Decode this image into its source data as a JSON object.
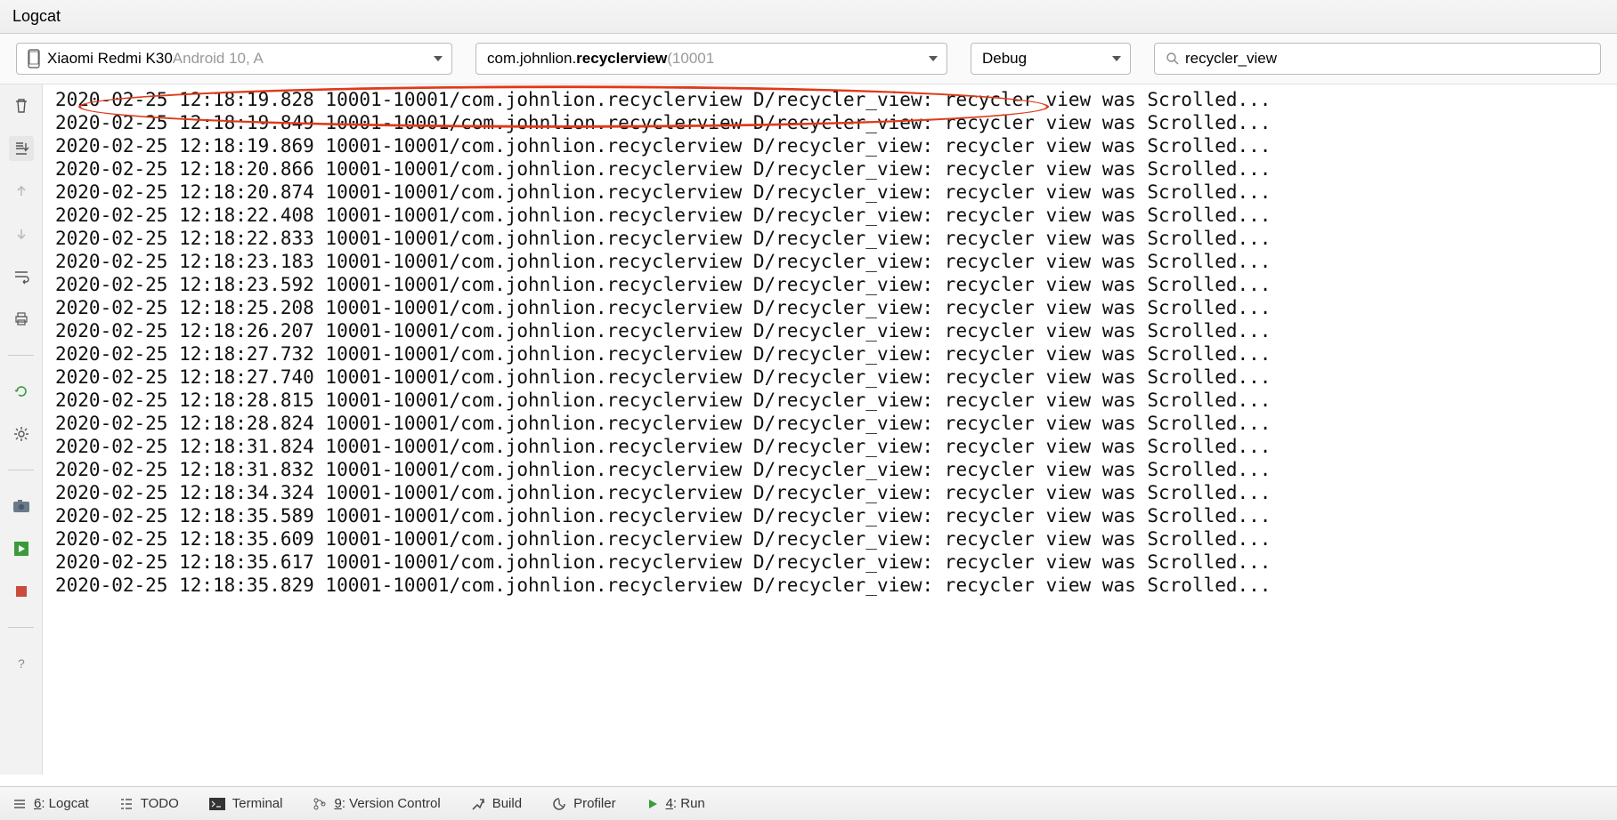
{
  "panel": {
    "title": "Logcat"
  },
  "filters": {
    "device": {
      "name": "Xiaomi Redmi K30",
      "suffix": " Android 10, A"
    },
    "package": {
      "prefix": "com.johnlion.",
      "bold": "recyclerview",
      "pid": " (10001"
    },
    "level": "Debug",
    "search": "recycler_view"
  },
  "gutter_icons": [
    "trash",
    "down-tray",
    "arrow-up",
    "arrow-down",
    "wrap",
    "printer",
    "restart",
    "gear",
    "camera",
    "record",
    "stop",
    "help"
  ],
  "log_prefix": {
    "pidtid": "10001-10001",
    "pkg": "com.johnlion.recyclerview",
    "tag": "D/recycler_view:",
    "msg": "recycler view was Scrolled..."
  },
  "log_entries": [
    {
      "date": "2020-02-25",
      "time": "12:18:19.828"
    },
    {
      "date": "2020-02-25",
      "time": "12:18:19.849"
    },
    {
      "date": "2020-02-25",
      "time": "12:18:19.869"
    },
    {
      "date": "2020-02-25",
      "time": "12:18:20.866"
    },
    {
      "date": "2020-02-25",
      "time": "12:18:20.874"
    },
    {
      "date": "2020-02-25",
      "time": "12:18:22.408"
    },
    {
      "date": "2020-02-25",
      "time": "12:18:22.833"
    },
    {
      "date": "2020-02-25",
      "time": "12:18:23.183"
    },
    {
      "date": "2020-02-25",
      "time": "12:18:23.592"
    },
    {
      "date": "2020-02-25",
      "time": "12:18:25.208"
    },
    {
      "date": "2020-02-25",
      "time": "12:18:26.207"
    },
    {
      "date": "2020-02-25",
      "time": "12:18:27.732"
    },
    {
      "date": "2020-02-25",
      "time": "12:18:27.740"
    },
    {
      "date": "2020-02-25",
      "time": "12:18:28.815"
    },
    {
      "date": "2020-02-25",
      "time": "12:18:28.824"
    },
    {
      "date": "2020-02-25",
      "time": "12:18:31.824"
    },
    {
      "date": "2020-02-25",
      "time": "12:18:31.832"
    },
    {
      "date": "2020-02-25",
      "time": "12:18:34.324"
    },
    {
      "date": "2020-02-25",
      "time": "12:18:35.589"
    },
    {
      "date": "2020-02-25",
      "time": "12:18:35.609"
    },
    {
      "date": "2020-02-25",
      "time": "12:18:35.617"
    },
    {
      "date": "2020-02-25",
      "time": "12:18:35.829"
    }
  ],
  "bottom_tabs": {
    "logcat": {
      "key": "6",
      "label": ": Logcat"
    },
    "todo": {
      "label": "TODO"
    },
    "terminal": {
      "label": "Terminal"
    },
    "vcs": {
      "key": "9",
      "label": ": Version Control"
    },
    "build": {
      "label": "Build"
    },
    "profiler": {
      "label": "Profiler"
    },
    "run": {
      "key": "4",
      "label": ": Run"
    }
  }
}
